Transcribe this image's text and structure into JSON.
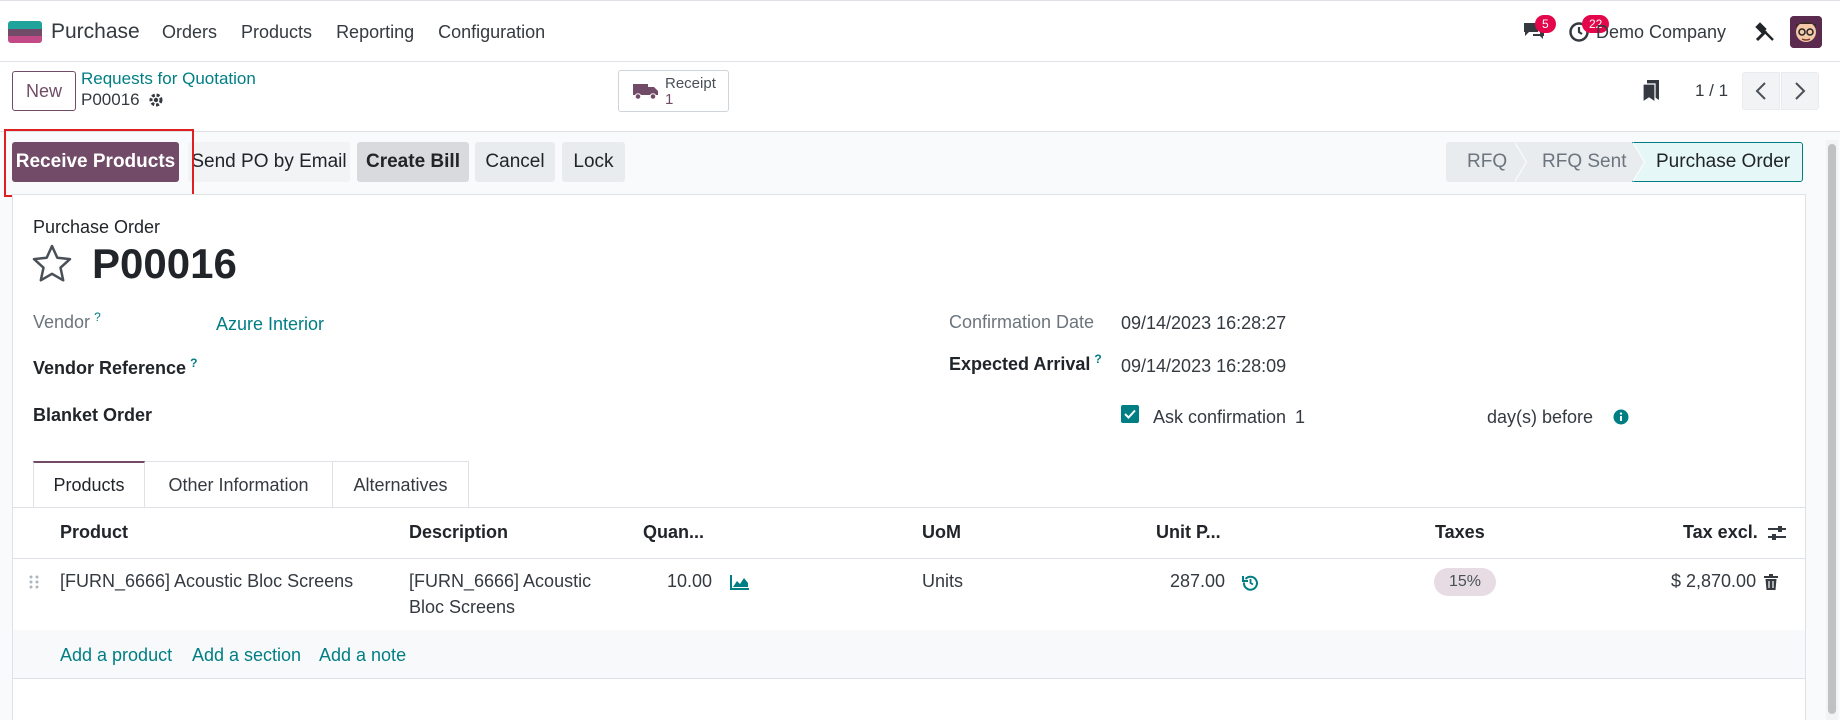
{
  "navbar": {
    "app_name": "Purchase",
    "menu": [
      "Orders",
      "Products",
      "Reporting",
      "Configuration"
    ],
    "chat_count": "5",
    "activity_count": "22",
    "company": "Demo Company"
  },
  "control_panel": {
    "new_label": "New",
    "breadcrumb": "Requests for Quotation",
    "record_name": "P00016",
    "receipt_label": "Receipt",
    "receipt_count": "1",
    "pager": "1 / 1"
  },
  "actions": {
    "receive": "Receive Products",
    "send_email": "Send PO by Email",
    "create_bill": "Create Bill",
    "cancel": "Cancel",
    "lock": "Lock"
  },
  "stages": [
    "RFQ",
    "RFQ Sent",
    "Purchase Order"
  ],
  "stage_active": "Purchase Order",
  "form": {
    "kind": "Purchase Order",
    "name": "P00016",
    "vendor_label": "Vendor",
    "vendor_value": "Azure Interior",
    "vendor_ref_label": "Vendor Reference",
    "blanket_label": "Blanket Order",
    "confirmation_label": "Confirmation Date",
    "confirmation_value": "09/14/2023 16:28:27",
    "expected_label": "Expected Arrival",
    "expected_value": "09/14/2023 16:28:09",
    "ask_label": "Ask confirmation",
    "ask_days": "1",
    "days_before": "day(s) before",
    "help_mark": "?"
  },
  "tabs": [
    "Products",
    "Other Information",
    "Alternatives"
  ],
  "table": {
    "headers": [
      "Product",
      "Description",
      "Quan...",
      "UoM",
      "Unit P...",
      "Taxes",
      "Tax excl."
    ],
    "rows": [
      {
        "product": "[FURN_6666] Acoustic Bloc Screens",
        "description_line1": "[FURN_6666] Acoustic",
        "description_line2": "Bloc Screens",
        "quantity": "10.00",
        "uom": "Units",
        "unit_price": "287.00",
        "tax": "15%",
        "subtotal": "$ 2,870.00"
      }
    ],
    "add_product": "Add a product",
    "add_section": "Add a section",
    "add_note": "Add a note"
  },
  "colors": {
    "brand": "#714b67",
    "accent": "#017e84",
    "badge": "#e3064a"
  }
}
